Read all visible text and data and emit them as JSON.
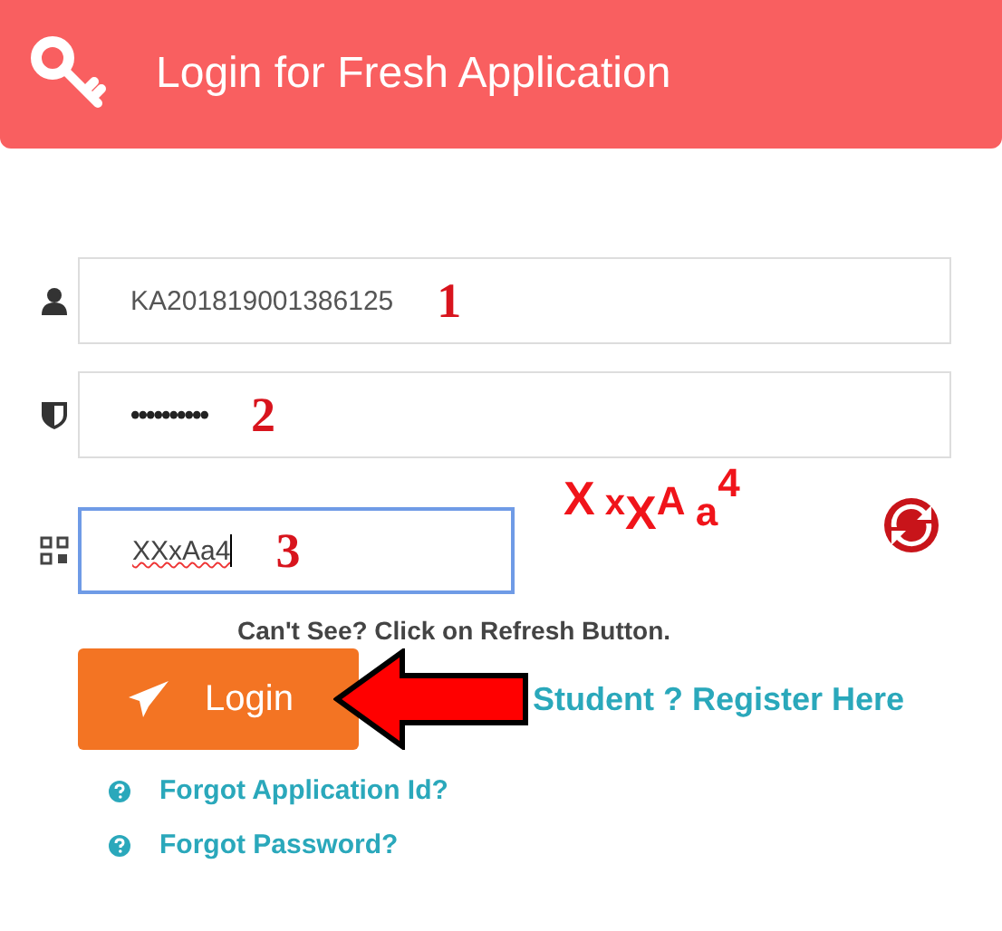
{
  "header": {
    "title": "Login for Fresh Application"
  },
  "fields": [
    {
      "kind": "user",
      "value": "KA201819001386125",
      "marker": "1"
    },
    {
      "kind": "password",
      "value": "••••••••••",
      "marker": "2"
    }
  ],
  "captcha": {
    "value": "XXxAa4",
    "marker": "3",
    "focused": true,
    "image_text": "X xXA a4",
    "hint": "Can't See? Click on Refresh Button."
  },
  "login_button": {
    "label": "Login"
  },
  "register_link": {
    "label": "Student ? Register Here"
  },
  "links": [
    {
      "label": "Forgot Application Id?"
    },
    {
      "label": "Forgot Password?"
    }
  ]
}
